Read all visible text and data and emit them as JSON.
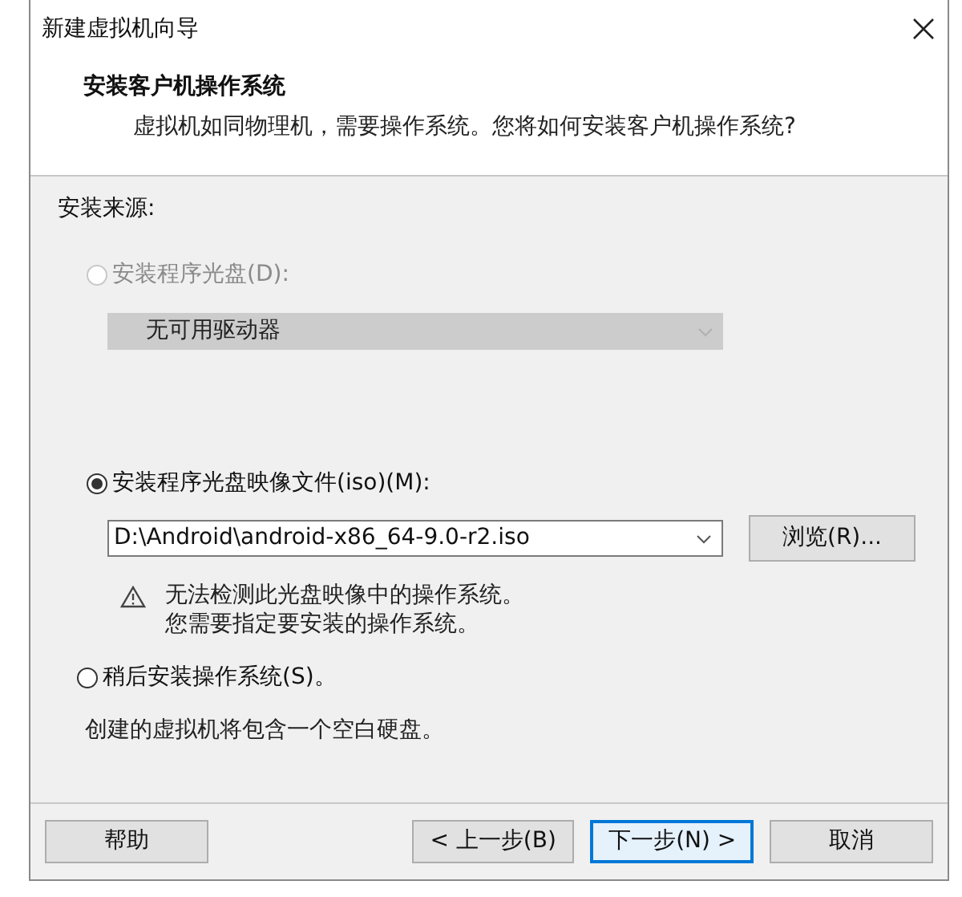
{
  "window": {
    "title": "新建虚拟机向导"
  },
  "header": {
    "title": "安装客户机操作系统",
    "subtitle": "虚拟机如同物理机，需要操作系统。您将如何安装客户机操作系统?"
  },
  "source_label": "安装来源:",
  "options": [
    {
      "kind": "disc",
      "label": "安装程序光盘(D):",
      "selected": false,
      "disabled": true,
      "dropdown": "无可用驱动器"
    },
    {
      "kind": "iso",
      "label": "安装程序光盘映像文件(iso)(M):",
      "selected": true,
      "disabled": false,
      "dropdown": "D:\\Android\\android-x86_64-9.0-r2.iso",
      "browse_button": "浏览(R)...",
      "warning": [
        "无法检测此光盘映像中的操作系统。",
        "您需要指定要安装的操作系统。"
      ]
    },
    {
      "kind": "later",
      "label": "稍后安装操作系统(S)。",
      "selected": false,
      "disabled": false,
      "note": "创建的虚拟机将包含一个空白硬盘。"
    }
  ],
  "buttons": [
    {
      "label": "帮助",
      "default": false
    },
    {
      "label": "< 上一步(B)",
      "default": false
    },
    {
      "label": "下一步(N) >",
      "default": true
    },
    {
      "label": "取消",
      "default": false
    }
  ]
}
